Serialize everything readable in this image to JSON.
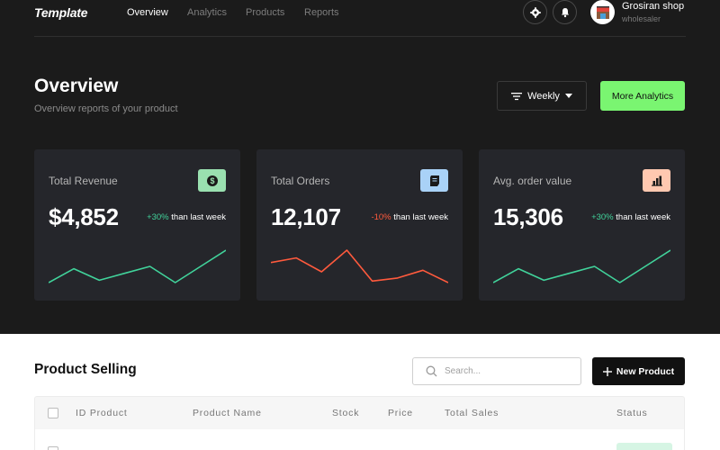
{
  "brand": {
    "logo": "Template"
  },
  "nav": {
    "items": [
      "Overview",
      "Analytics",
      "Products",
      "Reports"
    ]
  },
  "user": {
    "name": "Grosiran shop",
    "role": "wholesaler"
  },
  "header": {
    "title": "Overview",
    "subtitle": "Overview reports of your product",
    "period_label": "Weekly",
    "more_label": "More Analytics"
  },
  "colors": {
    "background_dark": "#1b1b1b",
    "card": "#25262b",
    "accent_green": "#7af571",
    "positive": "#41d39b",
    "negative": "#ff5a3d"
  },
  "stats": [
    {
      "title": "Total Revenue",
      "value": "$4,852",
      "change": "+30%",
      "change_text": "than last week",
      "trend": "up",
      "icon": "dollar-icon",
      "icon_bg": "#9ae0b0",
      "spark": [
        3,
        9,
        4,
        7,
        10,
        3,
        10,
        17
      ]
    },
    {
      "title": "Total Orders",
      "value": "12,107",
      "change": "-10%",
      "change_text": "than last week",
      "trend": "down",
      "icon": "receipt-icon",
      "icon_bg": "#a9d2f7",
      "spark": [
        14,
        17,
        8,
        22,
        2,
        4,
        9,
        1
      ]
    },
    {
      "title": "Avg. order value",
      "value": "15,306",
      "change": "+30%",
      "change_text": "than last week",
      "trend": "up",
      "icon": "bar-chart-icon",
      "icon_bg": "#ffc8b0",
      "spark": [
        3,
        9,
        4,
        7,
        10,
        3,
        10,
        17
      ]
    }
  ],
  "products": {
    "title": "Product Selling",
    "search_placeholder": "Search...",
    "new_label": "New Product",
    "columns": [
      "ID Product",
      "Product Name",
      "Stock",
      "Price",
      "Total Sales",
      "Status"
    ]
  }
}
